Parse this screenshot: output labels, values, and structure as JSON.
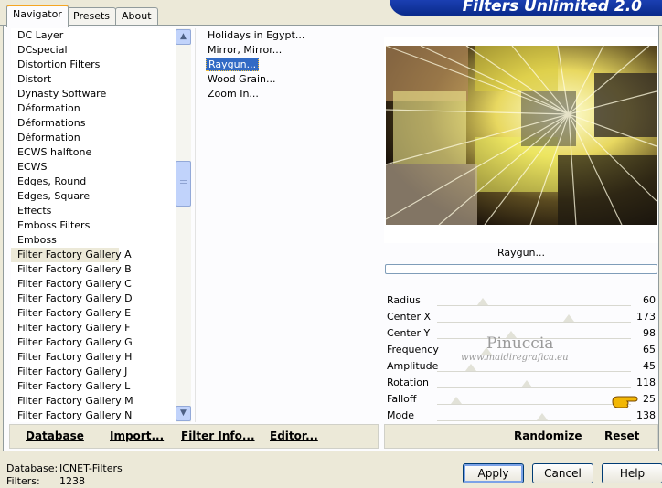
{
  "tabs": [
    {
      "label": "Navigator",
      "active": true
    },
    {
      "label": "Presets",
      "active": false
    },
    {
      "label": "About",
      "active": false
    }
  ],
  "banner": "Filters Unlimited 2.0",
  "categories": [
    "DC Layer",
    "DCspecial",
    "Distortion Filters",
    "Distort",
    "Dynasty Software",
    "Déformation",
    "Déformations",
    "Déformation",
    "ECWS halftone",
    "ECWS",
    "Edges, Round",
    "Edges, Square",
    "Effects",
    "Emboss Filters",
    "Emboss",
    "Filter Factory Gallery A",
    "Filter Factory Gallery B",
    "Filter Factory Gallery C",
    "Filter Factory Gallery D",
    "Filter Factory Gallery E",
    "Filter Factory Gallery F",
    "Filter Factory Gallery G",
    "Filter Factory Gallery H",
    "Filter Factory Gallery J",
    "Filter Factory Gallery L",
    "Filter Factory Gallery M",
    "Filter Factory Gallery N"
  ],
  "selected_category": "Filter Factory Gallery A",
  "filters": [
    "Holidays in Egypt...",
    "Mirror, Mirror...",
    "Raygun...",
    "Wood Grain...",
    "Zoom In..."
  ],
  "selected_filter": "Raygun...",
  "filter_name": "Raygun...",
  "params": [
    {
      "label": "Radius",
      "value": "60",
      "level": 0.235
    },
    {
      "label": "Center X",
      "value": "173",
      "level": 0.678
    },
    {
      "label": "Center Y",
      "value": "98",
      "level": 0.384
    },
    {
      "label": "Frequency",
      "value": "65",
      "level": 0.255
    },
    {
      "label": "Amplitude",
      "value": "45",
      "level": 0.176
    },
    {
      "label": "Rotation",
      "value": "118",
      "level": 0.463
    },
    {
      "label": "Falloff",
      "value": "25",
      "level": 0.098
    },
    {
      "label": "Mode",
      "value": "138",
      "level": 0.541
    }
  ],
  "watermark": {
    "line1": "Pinuccia",
    "line2": "www.maidiregrafica.eu"
  },
  "left_buttons": {
    "database": "Database",
    "import": "Import...",
    "filter_info": "Filter Info...",
    "editor": "Editor..."
  },
  "right_buttons": {
    "randomize": "Randomize",
    "reset": "Reset"
  },
  "info": {
    "database_label": "Database:",
    "database_value": "ICNET-Filters",
    "filters_label": "Filters:",
    "filters_value": "1238"
  },
  "dialog_buttons": {
    "apply": "Apply",
    "cancel": "Cancel",
    "help": "Help"
  }
}
